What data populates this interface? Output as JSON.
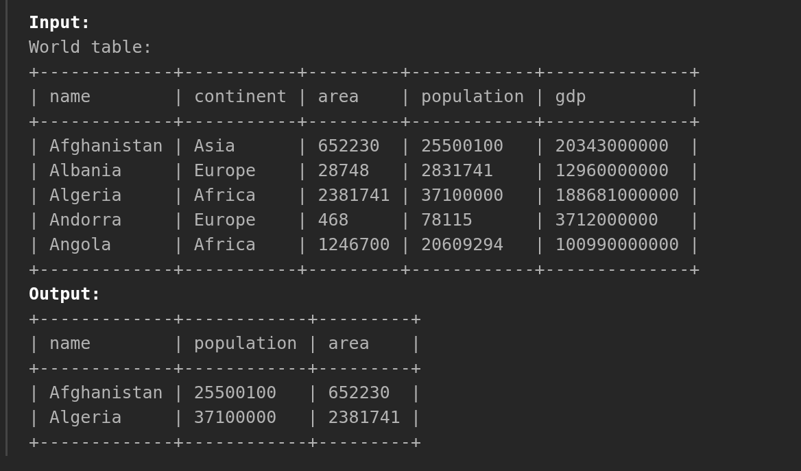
{
  "lines": [
    {
      "kind": "heading",
      "text": "Input:"
    },
    {
      "kind": "text",
      "text": "World table:"
    },
    {
      "kind": "text",
      "text": "+-------------+-----------+---------+------------+--------------+"
    },
    {
      "kind": "text",
      "text": "| name        | continent | area    | population | gdp          |"
    },
    {
      "kind": "text",
      "text": "+-------------+-----------+---------+------------+--------------+"
    },
    {
      "kind": "text",
      "text": "| Afghanistan | Asia      | 652230  | 25500100   | 20343000000  |"
    },
    {
      "kind": "text",
      "text": "| Albania     | Europe    | 28748   | 2831741    | 12960000000  |"
    },
    {
      "kind": "text",
      "text": "| Algeria     | Africa    | 2381741 | 37100000   | 188681000000 |"
    },
    {
      "kind": "text",
      "text": "| Andorra     | Europe    | 468     | 78115      | 3712000000   |"
    },
    {
      "kind": "text",
      "text": "| Angola      | Africa    | 1246700 | 20609294   | 100990000000 |"
    },
    {
      "kind": "text",
      "text": "+-------------+-----------+---------+------------+--------------+"
    },
    {
      "kind": "heading",
      "text": "Output:"
    },
    {
      "kind": "text",
      "text": "+-------------+------------+---------+"
    },
    {
      "kind": "text",
      "text": "| name        | population | area    |"
    },
    {
      "kind": "text",
      "text": "+-------------+------------+---------+"
    },
    {
      "kind": "text",
      "text": "| Afghanistan | 25500100   | 652230  |"
    },
    {
      "kind": "text",
      "text": "| Algeria     | 37100000   | 2381741 |"
    },
    {
      "kind": "text",
      "text": "+-------------+------------+---------+"
    }
  ]
}
